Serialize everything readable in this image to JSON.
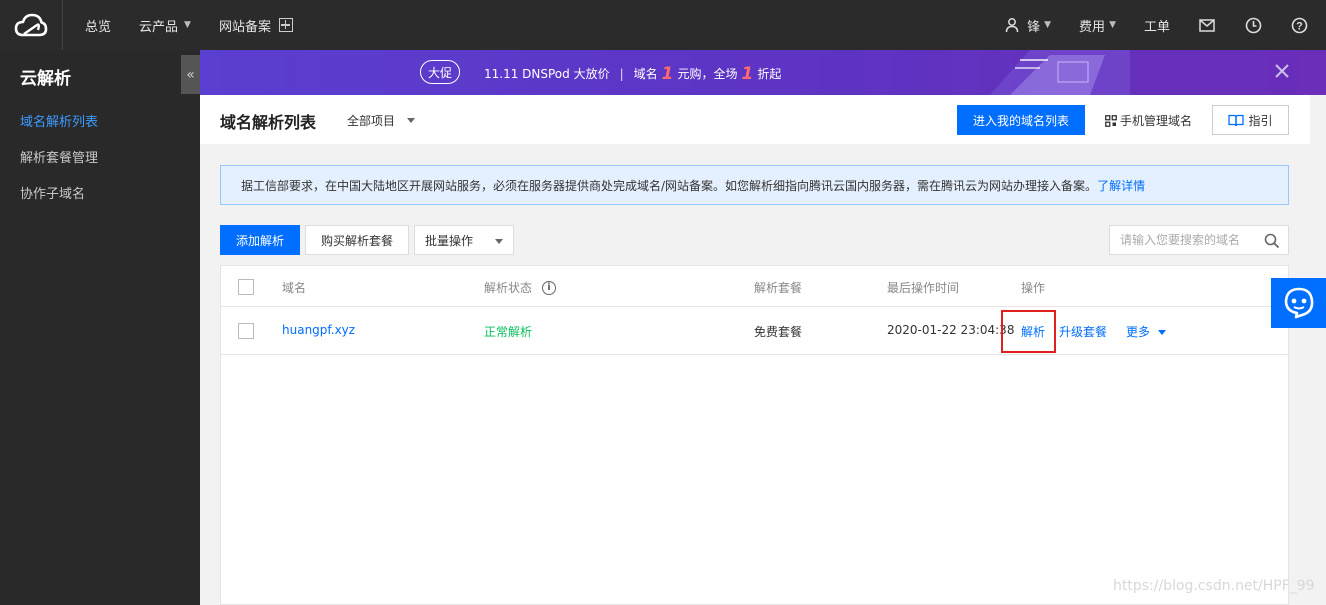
{
  "topbar": {
    "nav": [
      "总览",
      "云产品",
      "网站备案"
    ],
    "user": "锋",
    "billing": "费用",
    "ticket": "工单",
    "icons": [
      "cloud-logo-icon",
      "plus-box-icon",
      "user-icon",
      "mail-icon",
      "clock-icon",
      "help-icon"
    ]
  },
  "sidebar": {
    "title": "云解析",
    "items": [
      {
        "label": "域名解析列表",
        "active": true
      },
      {
        "label": "解析套餐管理",
        "active": false
      },
      {
        "label": "协作子域名",
        "active": false
      }
    ],
    "collapse_glyph": "«"
  },
  "banner": {
    "badge": "大促",
    "text1": "11.11 DNSPod 大放价",
    "sep": "|",
    "text2": "域名",
    "num1": "1",
    "text3": "元购，全场",
    "num2": "1",
    "text4": "折起"
  },
  "header": {
    "title": "域名解析列表",
    "project": "全部项目",
    "enter_btn": "进入我的域名列表",
    "mobile": "手机管理域名",
    "guide": "指引"
  },
  "notice": {
    "text": "据工信部要求，在中国大陆地区开展网站服务，必须在服务器提供商处完成域名/网站备案。如您解析细指向腾讯云国内服务器，需在腾讯云为网站办理接入备案。",
    "link": "了解详情"
  },
  "toolbar": {
    "add": "添加解析",
    "buy": "购买解析套餐",
    "batch": "批量操作",
    "search_placeholder": "请输入您要搜索的域名"
  },
  "table": {
    "columns": [
      "域名",
      "解析状态",
      "解析套餐",
      "最后操作时间",
      "操作"
    ],
    "rows": [
      {
        "domain": "huangpf.xyz",
        "status": "正常解析",
        "plan": "免费套餐",
        "time": "2020-01-22 23:04:38",
        "actions": [
          "解析",
          "升级套餐",
          "更多"
        ]
      }
    ]
  },
  "watermark": "https://blog.csdn.net/HPF_99",
  "colors": {
    "primary": "#006eff",
    "success": "#0abf5b",
    "highlight": "#e0201e",
    "topbar": "#2b2b2b",
    "sidebar": "#292929"
  }
}
